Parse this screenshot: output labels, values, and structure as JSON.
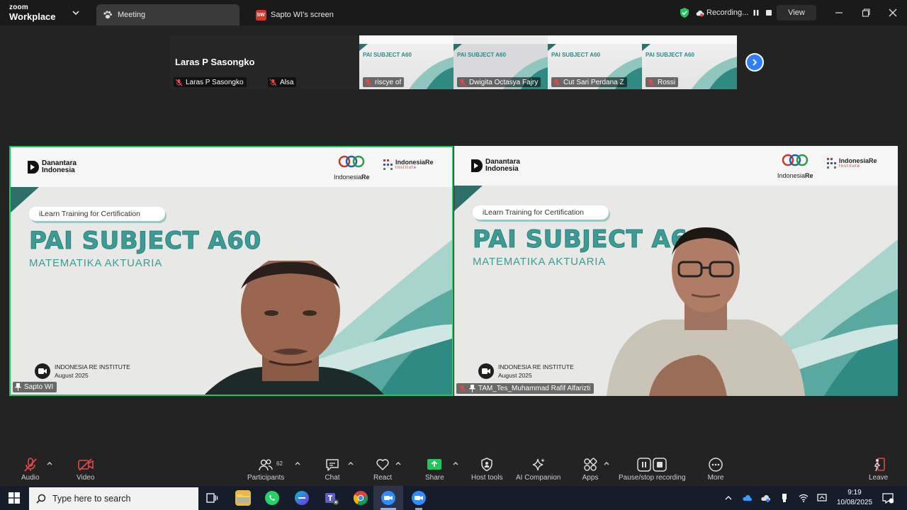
{
  "app": {
    "brand_line1": "zoom",
    "brand_line2": "Workplace"
  },
  "tabs": [
    {
      "label": "Meeting"
    },
    {
      "label": "Sapto WI's screen",
      "badge": "SW"
    }
  ],
  "recording": {
    "label": "Recording..."
  },
  "view": {
    "label": "View"
  },
  "thumbnails": {
    "featured_name": "Laras P Sasongko",
    "items": [
      {
        "name": "Laras P Sasongko"
      },
      {
        "name": "Alsa"
      },
      {
        "name": "riscye of"
      },
      {
        "name": "Dwigita Octasya Fajry"
      },
      {
        "name": "Cut Sari Perdana Z"
      },
      {
        "name": "Rossi"
      }
    ],
    "mini_slide_title": "PAI SUBJECT A60"
  },
  "slide": {
    "brand_left": "Danantara Indonesia",
    "brand_left_l1": "Danantara",
    "brand_left_l2": "Indonesia",
    "brand_mid_a": "Indonesia",
    "brand_mid_b": "Re",
    "brand_right_l1": "IndonesiaRe",
    "brand_right_l2": "Institute",
    "pill": "iLearn Training for Certification",
    "title": "PAI SUBJECT A60",
    "subtitle": "MATEMATIKA AKTUARIA",
    "inst_l1": "INDONESIA RE INSTITUTE",
    "inst_l2": "August 2025"
  },
  "tiles": [
    {
      "name": "Sapto WI"
    },
    {
      "name": "TAM_Tes_Muhammad Rafif Alfarizti"
    }
  ],
  "toolbar": {
    "audio": "Audio",
    "video": "Video",
    "participants": "Participants",
    "participants_count": "62",
    "chat": "Chat",
    "react": "React",
    "share": "Share",
    "host_tools": "Host tools",
    "ai_companion": "AI Companion",
    "apps": "Apps",
    "pause_stop": "Pause/stop recording",
    "more": "More",
    "leave": "Leave"
  },
  "taskbar": {
    "search_placeholder": "Type here to search",
    "time": "9:19",
    "date": "10/08/2025"
  },
  "colors": {
    "accent": "#2d7ff9",
    "active_speaker": "#22c55e",
    "slide_teal": "#3d9b95",
    "share_green": "#22c55e"
  }
}
